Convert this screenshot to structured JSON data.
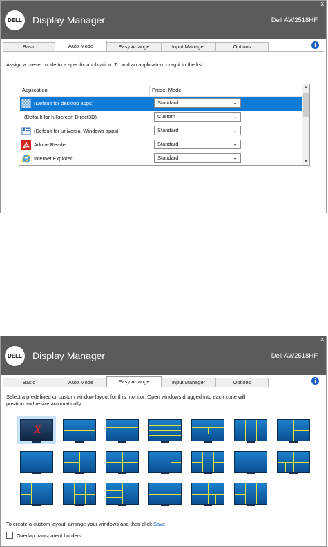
{
  "app": {
    "title": "Display Manager",
    "logo_text": "DELL",
    "model": "Dell AW2518HF",
    "close_glyph": "x"
  },
  "tabs": [
    {
      "label": "Basic"
    },
    {
      "label": "Auto Mode"
    },
    {
      "label": "Easy Arrange"
    },
    {
      "label": "Input Manager"
    },
    {
      "label": "Options"
    }
  ],
  "info_glyph": "i",
  "auto_mode": {
    "instructions": "Assign a preset mode to a specific application.  To add an application, drag it to the list:",
    "columns": {
      "application": "Application",
      "preset_mode": "Preset Mode"
    },
    "rows": [
      {
        "name": "(Default for desktop apps)",
        "mode": "Standard",
        "icon": "desktop-apps-icon",
        "selected": true
      },
      {
        "name": "(Default for fullscreen Direct3D)",
        "mode": "Custom",
        "icon": "blank-icon",
        "selected": false
      },
      {
        "name": "(Default for universal Windows apps)",
        "mode": "Standard",
        "icon": "windows-app-icon",
        "selected": false
      },
      {
        "name": "Adobe Reader",
        "mode": "Standard",
        "icon": "adobe-reader-icon",
        "selected": false
      },
      {
        "name": "Internet Explorer",
        "mode": "Standard",
        "icon": "internet-explorer-icon",
        "selected": false
      }
    ]
  },
  "easy_arrange": {
    "instructions_line1": "Select a predefined or custom window layout for this monitor.  Open windows dragged into each zone will",
    "instructions_line2": "position and resize automatically:",
    "footer_text": "To create a custom layout, arrange your windows and then click",
    "save_label": "Save",
    "checkbox_label": "Overlap transparent borders",
    "checkbox_checked": false
  },
  "colors": {
    "titlebar": "#5b5b5b",
    "selection": "#0f7bd6",
    "zone_line": "#e7e23a",
    "link": "#1e5fbf"
  }
}
